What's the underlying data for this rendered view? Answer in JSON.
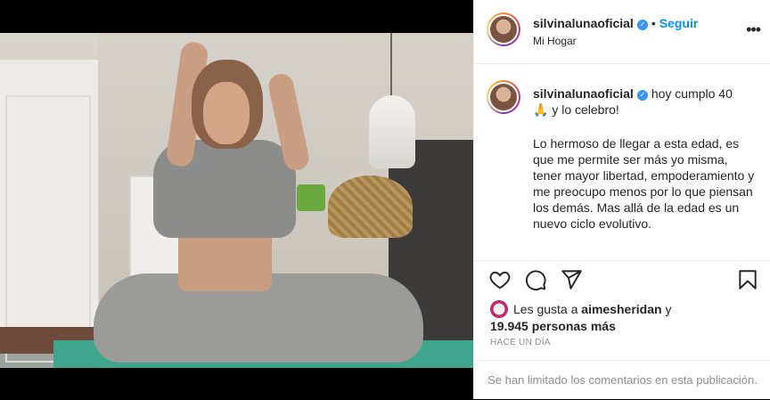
{
  "post": {
    "username": "silvinalunaoficial",
    "follow_label": "Seguir",
    "separator": "•",
    "location": "Mi Hogar",
    "more_label": "•••",
    "verified_label": "✓"
  },
  "caption": {
    "username": "silvinalunaoficial",
    "line1": "hoy cumplo 40",
    "line2_emoji": "🙏",
    "line2": "y lo celebro!",
    "body": "Lo hermoso de llegar a esta edad, es que me permite ser más yo misma, tener mayor libertad, empoderamiento y me preocupo menos por lo que piensan los demás. Mas allá de la edad es un nuevo ciclo evolutivo."
  },
  "actions": {
    "icons": [
      "heart-icon",
      "comment-icon",
      "share-icon",
      "bookmark-icon"
    ]
  },
  "likes": {
    "prefix": "Les gusta a",
    "liker": "aimesheridan",
    "conjunction": "y",
    "count_text": "19.945 personas más"
  },
  "time": "HACE UN DÍA",
  "comments_notice": "Se han limitado los comentarios en esta publicación."
}
